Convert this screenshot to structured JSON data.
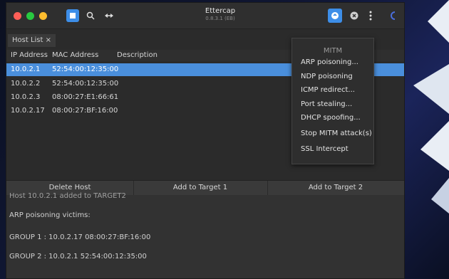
{
  "window": {
    "title": "Ettercap",
    "subtitle": "0.8.3.1 (EB)"
  },
  "tabs": [
    {
      "label": "Host List ×"
    }
  ],
  "table": {
    "headers": [
      "IP Address",
      "MAC Address",
      "Description"
    ],
    "rows": [
      {
        "ip": "10.0.2.1",
        "mac": "52:54:00:12:35:00",
        "selected": true
      },
      {
        "ip": "10.0.2.2",
        "mac": "52:54:00:12:35:00"
      },
      {
        "ip": "10.0.2.3",
        "mac": "08:00:27:E1:66:61"
      },
      {
        "ip": "10.0.2.17",
        "mac": "08:00:27:BF:16:00"
      }
    ]
  },
  "buttons": {
    "delete": "Delete Host",
    "target1": "Add to Target 1",
    "target2": "Add to Target 2"
  },
  "log": {
    "cut_line": "Host 10.0.2.1 added to TARGET2",
    "line1": "ARP poisoning victims:",
    "line2": "GROUP 1 : 10.0.2.17 08:00:27:BF:16:00",
    "line3": "GROUP 2 : 10.0.2.1 52:54:00:12:35:00"
  },
  "menu": {
    "title": "MITM",
    "items": [
      "ARP poisoning...",
      "NDP poisoning",
      "ICMP redirect...",
      "Port stealing...",
      "DHCP spoofing...",
      "Stop MITM attack(s)",
      "SSL Intercept"
    ]
  },
  "icons": {
    "search": "search-icon",
    "arrows": "arrows-icon",
    "mitm": "mitm-globe-icon",
    "close": "close-icon",
    "more": "kebab-menu-icon",
    "extra": "ettercap-logo-icon"
  },
  "colors": {
    "accent": "#3d8ee8",
    "selected_row": "#4a8fdc"
  }
}
